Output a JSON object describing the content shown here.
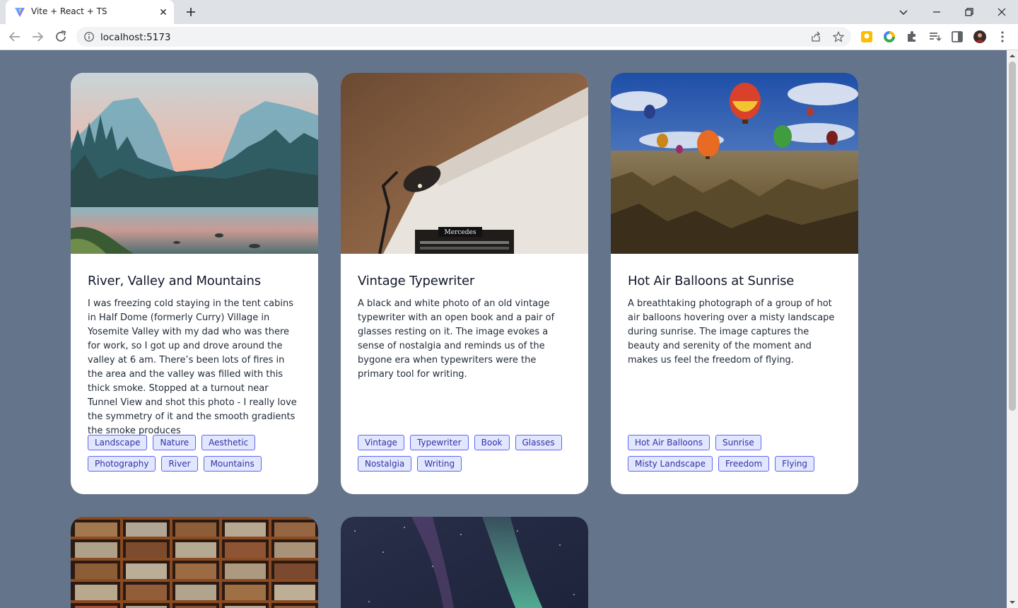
{
  "browser": {
    "tab_title": "Vite + React + TS",
    "url": "localhost:5173"
  },
  "cards": [
    {
      "title": "River, Valley and Mountains",
      "description": "I was freezing cold staying in the tent cabins in Half Dome (formerly Curry) Village in Yosemite Valley with my dad who was there for work, so I got up and drove around the valley at 6 am. There’s been lots of fires in the area and the valley was filled with this thick smoke. Stopped at a turnout near Tunnel View and shot this photo - I really love the symmetry of it and the smooth gradients the smoke produces",
      "tags": [
        "Landscape",
        "Nature",
        "Aesthetic",
        "Photography",
        "River",
        "Mountains"
      ]
    },
    {
      "title": "Vintage Typewriter",
      "description": "A black and white photo of an old vintage typewriter with an open book and a pair of glasses resting on it. The image evokes a sense of nostalgia and reminds us of the bygone era when typewriters were the primary tool for writing.",
      "tags": [
        "Vintage",
        "Typewriter",
        "Book",
        "Glasses",
        "Nostalgia",
        "Writing"
      ],
      "image_label": "Mercedes"
    },
    {
      "title": "Hot Air Balloons at Sunrise",
      "description": "A breathtaking photograph of a group of hot air balloons hovering over a misty landscape during sunrise. The image captures the beauty and serenity of the moment and makes us feel the freedom of flying.",
      "tags": [
        "Hot Air Balloons",
        "Sunrise",
        "Misty Landscape",
        "Freedom",
        "Flying"
      ]
    }
  ],
  "colors": {
    "page_bg": "#64748b",
    "tag_text": "#3730a3",
    "tag_bg": "#e0e7ff",
    "tag_border": "#6366f1"
  }
}
